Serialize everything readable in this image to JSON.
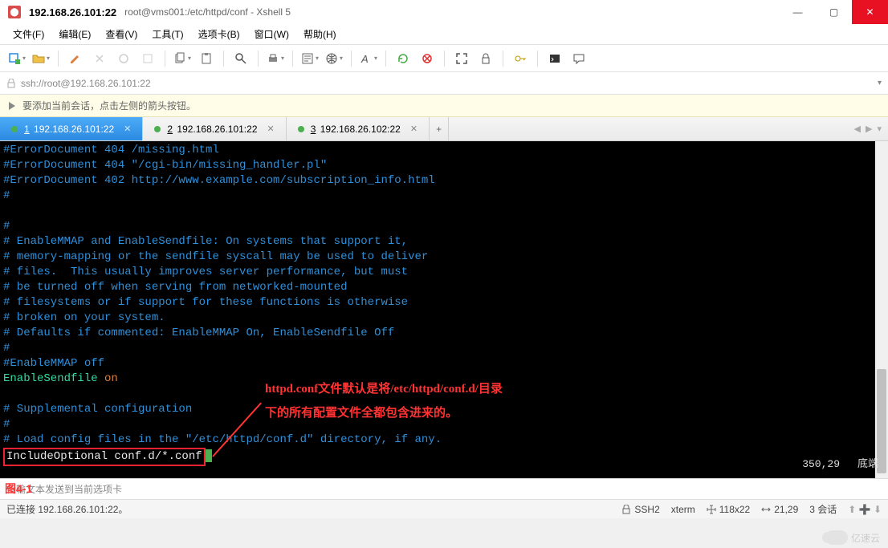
{
  "window": {
    "title_ip": "192.168.26.101:22",
    "title_path": "root@vms001:/etc/httpd/conf - Xshell 5"
  },
  "menu": {
    "file": "文件(F)",
    "edit": "编辑(E)",
    "view": "查看(V)",
    "tools": "工具(T)",
    "tabs": "选项卡(B)",
    "window": "窗口(W)",
    "help": "帮助(H)"
  },
  "address": {
    "url": "ssh://root@192.168.26.101:22"
  },
  "infobar": {
    "text": "要添加当前会话，点击左侧的箭头按钮。"
  },
  "tabs": {
    "items": [
      {
        "num": "1",
        "label": "192.168.26.101:22"
      },
      {
        "num": "2",
        "label": "192.168.26.101:22"
      },
      {
        "num": "3",
        "label": "192.168.26.102:22"
      }
    ]
  },
  "terminal_lines": [
    {
      "t": "#ErrorDocument 404 /missing.html",
      "c": "comment"
    },
    {
      "t": "#ErrorDocument 404 \"/cgi-bin/missing_handler.pl\"",
      "c": "comment"
    },
    {
      "t": "#ErrorDocument 402 http://www.example.com/subscription_info.html",
      "c": "comment"
    },
    {
      "t": "#",
      "c": "comment"
    },
    {
      "t": "",
      "c": ""
    },
    {
      "t": "#",
      "c": "comment"
    },
    {
      "t": "# EnableMMAP and EnableSendfile: On systems that support it,",
      "c": "comment"
    },
    {
      "t": "# memory-mapping or the sendfile syscall may be used to deliver",
      "c": "comment"
    },
    {
      "t": "# files.  This usually improves server performance, but must",
      "c": "comment"
    },
    {
      "t": "# be turned off when serving from networked-mounted",
      "c": "comment"
    },
    {
      "t": "# filesystems or if support for these functions is otherwise",
      "c": "comment"
    },
    {
      "t": "# broken on your system.",
      "c": "comment"
    },
    {
      "t": "# Defaults if commented: EnableMMAP On, EnableSendfile Off",
      "c": "comment"
    },
    {
      "t": "#",
      "c": "comment"
    },
    {
      "t": "#EnableMMAP off",
      "c": "comment"
    }
  ],
  "enable_line": {
    "kw": "EnableSendfile",
    "val": "on"
  },
  "supp_lines": [
    {
      "t": "# Supplemental configuration",
      "c": "comment"
    },
    {
      "t": "#",
      "c": "comment"
    },
    {
      "t": "# Load config files in the \"/etc/httpd/conf.d\" directory, if any.",
      "c": "comment"
    }
  ],
  "include_line": "IncludeOptional conf.d/*.conf",
  "annotation": {
    "line1": "httpd.conf文件默认是将/etc/httpd/conf.d/目录",
    "line2": "下的所有配置文件全都包含进来的。"
  },
  "posinfo": {
    "pos": "350,29",
    "label": "底端"
  },
  "figure_label": "图4-1",
  "inputline": "传输文本发送到当前选项卡",
  "status": {
    "conn": "已连接 192.168.26.101:22。",
    "proto": "SSH2",
    "term": "xterm",
    "size": "118x22",
    "cursor": "21,29",
    "sessions": "3 会话"
  },
  "watermark_text": "亿速云"
}
